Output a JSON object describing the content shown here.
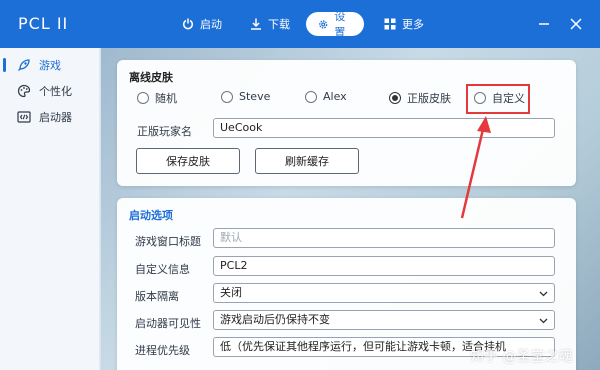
{
  "app": {
    "title": "PCL II"
  },
  "nav": {
    "launch": "启动",
    "download": "下载",
    "settings": "设置",
    "more": "更多"
  },
  "sidebar": {
    "items": [
      {
        "label": "游戏",
        "icon": "rocket-icon",
        "active": true
      },
      {
        "label": "个性化",
        "icon": "palette-icon",
        "active": false
      },
      {
        "label": "启动器",
        "icon": "code-window-icon",
        "active": false
      }
    ]
  },
  "skin_card": {
    "title": "离线皮肤",
    "options": [
      "随机",
      "Steve",
      "Alex",
      "正版皮肤",
      "自定义"
    ],
    "selected": "正版皮肤",
    "player_name_label": "正版玩家名",
    "player_name_value": "UeCook",
    "save_button": "保存皮肤",
    "refresh_button": "刷新缓存"
  },
  "launch_card": {
    "title": "启动选项",
    "window_title_label": "游戏窗口标题",
    "window_title_placeholder": "默认",
    "custom_info_label": "自定义信息",
    "custom_info_value": "PCL2",
    "version_isolation_label": "版本隔离",
    "version_isolation_value": "关闭",
    "launcher_visibility_label": "启动器可见性",
    "launcher_visibility_value": "游戏启动后仍保持不变",
    "process_priority_label": "进程优先级",
    "process_priority_value": "低（优先保证其他程序运行，但可能让游戏卡顿，适合挂机"
  },
  "watermark": "知乎 @圣堂之魂",
  "colors": {
    "accent": "#1d6fd8",
    "annotation": "#e4393c"
  }
}
